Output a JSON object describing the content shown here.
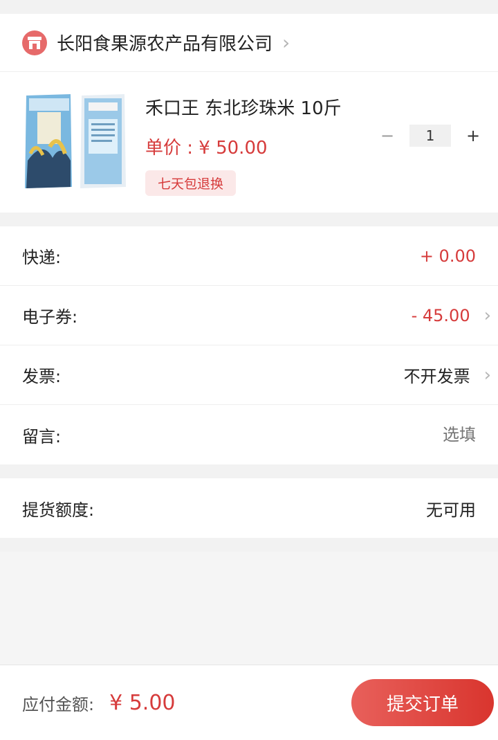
{
  "shop": {
    "name": "长阳食果源农产品有限公司",
    "icon": "store-icon"
  },
  "product": {
    "title": "禾口王 东北珍珠米 10斤",
    "price": "单价 : ¥ 50.00",
    "tag": "七天包退换",
    "quantity": "1",
    "minus": "−",
    "plus": "+"
  },
  "order_rows": [
    {
      "label": "快递:",
      "value": "+ 0.00"
    },
    {
      "label": "电子券:",
      "value": "- 45.00"
    },
    {
      "label": "发票:",
      "value": "不开发票"
    },
    {
      "label": "留言:",
      "value": "选填"
    }
  ],
  "pickup": {
    "label": "提货额度:",
    "value": "无可用"
  },
  "footer": {
    "pay_label": "应付金额:",
    "pay_amount": "¥ 5.00",
    "submit_label": "提交订单"
  },
  "colors": {
    "accent": "#d63b3b",
    "button": "#e0473f"
  }
}
